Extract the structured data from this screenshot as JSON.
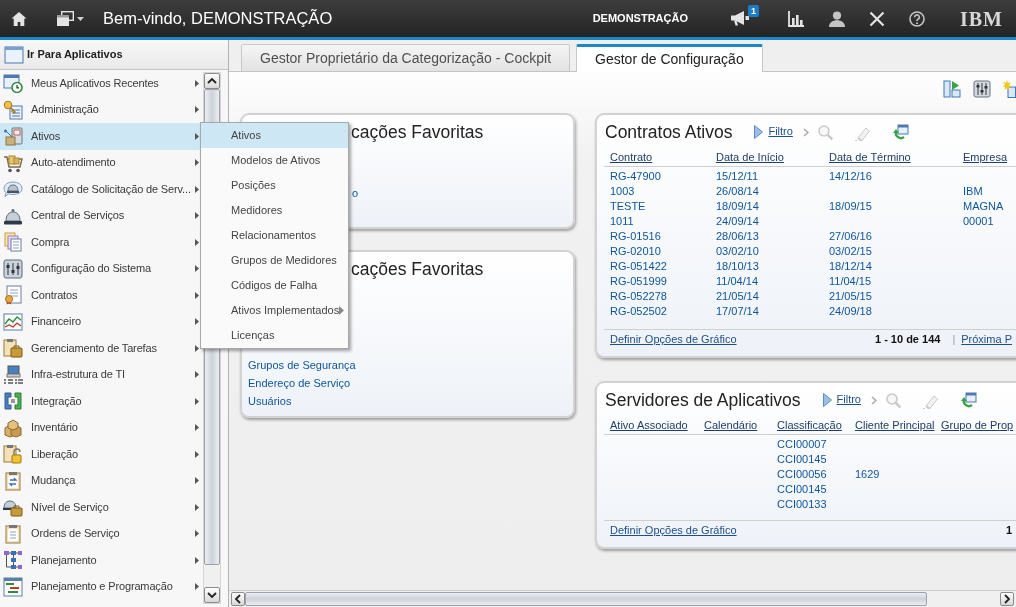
{
  "topbar": {
    "title": "Bem-vindo, DEMONSTRAÇÃO",
    "user": "DEMONSTRAÇÃO",
    "notifications": "1",
    "logo": "IBM"
  },
  "sidebar": {
    "title": "Ir Para Aplicativos",
    "items": [
      {
        "label": "Meus Aplicativos Recentes",
        "selected": false,
        "submenu": true
      },
      {
        "label": "Administração",
        "selected": false,
        "submenu": true
      },
      {
        "label": "Ativos",
        "selected": true,
        "submenu": true
      },
      {
        "label": "Auto-atendimento",
        "selected": false,
        "submenu": true
      },
      {
        "label": "Catálogo de Solicitação de Serv...",
        "selected": false,
        "submenu": true
      },
      {
        "label": "Central de Serviços",
        "selected": false,
        "submenu": true
      },
      {
        "label": "Compra",
        "selected": false,
        "submenu": true
      },
      {
        "label": "Configuração do Sistema",
        "selected": false,
        "submenu": true
      },
      {
        "label": "Contratos",
        "selected": false,
        "submenu": true
      },
      {
        "label": "Financeiro",
        "selected": false,
        "submenu": true
      },
      {
        "label": "Gerenciamento de Tarefas",
        "selected": false,
        "submenu": true
      },
      {
        "label": "Infra-estrutura de TI",
        "selected": false,
        "submenu": true
      },
      {
        "label": "Integração",
        "selected": false,
        "submenu": true
      },
      {
        "label": "Inventário",
        "selected": false,
        "submenu": true
      },
      {
        "label": "Liberação",
        "selected": false,
        "submenu": true
      },
      {
        "label": "Mudança",
        "selected": false,
        "submenu": true
      },
      {
        "label": "Nível de Serviço",
        "selected": false,
        "submenu": true
      },
      {
        "label": "Ordens de Serviço",
        "selected": false,
        "submenu": true
      },
      {
        "label": "Planejamento",
        "selected": false,
        "submenu": true
      },
      {
        "label": "Planejamento e Programação",
        "selected": false,
        "submenu": true
      }
    ]
  },
  "flyout": {
    "items": [
      {
        "label": "Ativos",
        "selected": true,
        "submenu": false
      },
      {
        "label": "Modelos de Ativos",
        "selected": false,
        "submenu": false
      },
      {
        "label": "Posições",
        "selected": false,
        "submenu": false
      },
      {
        "label": "Medidores",
        "selected": false,
        "submenu": false
      },
      {
        "label": "Relacionamentos",
        "selected": false,
        "submenu": false
      },
      {
        "label": "Grupos de Medidores",
        "selected": false,
        "submenu": false
      },
      {
        "label": "Códigos de Falha",
        "selected": false,
        "submenu": false
      },
      {
        "label": "Ativos Implementados",
        "selected": false,
        "submenu": true
      },
      {
        "label": "Licenças",
        "selected": false,
        "submenu": false
      }
    ]
  },
  "tabs": [
    {
      "label": "Gestor Proprietário da Categorização - Cockpit",
      "selected": false
    },
    {
      "label": "Gestor de Configuração",
      "selected": true
    }
  ],
  "cards": [
    {
      "kind": "links",
      "title": "cações Favoritas",
      "links": [
        "o"
      ]
    },
    {
      "kind": "table",
      "title": "Contratos Ativos",
      "filter": "Filtro",
      "tools": [
        {
          "kind": "search",
          "disabled": true
        },
        {
          "kind": "clear",
          "disabled": true
        },
        {
          "kind": "refresh",
          "disabled": false
        }
      ],
      "columns": [
        "Contrato",
        "Data de Início",
        "Data de Término",
        "Empresa"
      ],
      "rows": [
        [
          "RG-47900",
          "15/12/11",
          "14/12/16",
          null
        ],
        [
          "1003",
          "26/08/14",
          null,
          "IBM"
        ],
        [
          "TESTE",
          "18/09/14",
          "18/09/15",
          "MAGNA"
        ],
        [
          "1011",
          "24/09/14",
          null,
          "00001"
        ],
        [
          "RG-01516",
          "28/06/13",
          "27/06/16",
          null
        ],
        [
          "RG-02010",
          "03/02/10",
          "03/02/15",
          null
        ],
        [
          "RG-051422",
          "18/10/13",
          "18/12/14",
          null
        ],
        [
          "RG-051999",
          "11/04/14",
          "11/04/15",
          null
        ],
        [
          "RG-052278",
          "21/05/14",
          "21/05/15",
          null
        ],
        [
          "RG-052502",
          "17/07/14",
          "24/09/18",
          null
        ]
      ],
      "footer_link": "Definir Opções de Gráfico",
      "pagination": "1 - 10 de 144",
      "separator": "|",
      "next": "Próxima P"
    },
    {
      "kind": "links",
      "title": "cações Favoritas",
      "links": [
        "Grupos de Segurança",
        "Endereço de Serviço",
        "Usuários"
      ]
    },
    {
      "kind": "table",
      "title": "Servidores de Aplicativos",
      "filter": "Filtro",
      "tools": [
        {
          "kind": "search",
          "disabled": true
        },
        {
          "kind": "clear",
          "disabled": true
        },
        {
          "kind": "refresh",
          "disabled": false
        }
      ],
      "columns": [
        "Ativo Associado",
        "Calendário",
        "Classificação",
        "Cliente Principal",
        "Grupo de Prop"
      ],
      "rows": [
        [
          null,
          null,
          "CCI00007",
          null,
          null
        ],
        [
          null,
          null,
          "CCI00145",
          null,
          null
        ],
        [
          null,
          null,
          "CCI00056",
          "1629",
          null
        ],
        [
          null,
          null,
          "CCI00145",
          null,
          null
        ],
        [
          null,
          null,
          "CCI00133",
          null,
          null
        ]
      ],
      "footer_link": "Definir Opções de Gráfico",
      "pagination": "1"
    }
  ]
}
